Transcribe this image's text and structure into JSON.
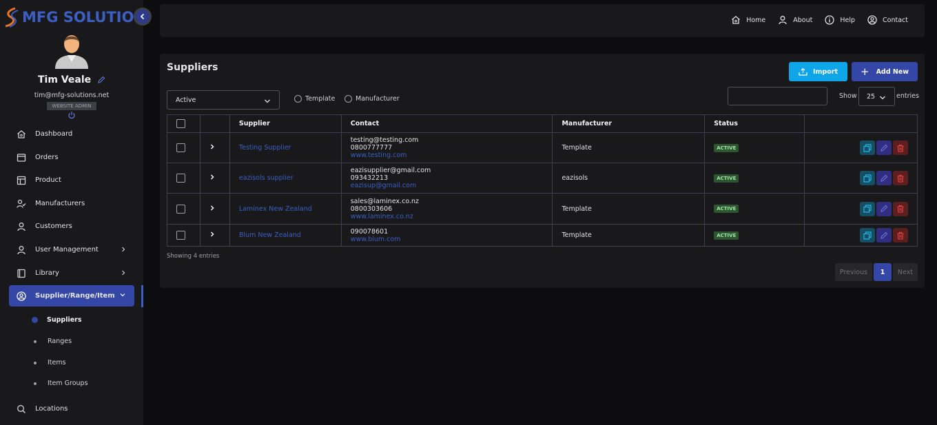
{
  "brand": {
    "name": "MFG SOLUTION"
  },
  "user": {
    "name": "Tim Veale",
    "email": "tim@mfg-solutions.net",
    "role": "WEBSITE ADMIN"
  },
  "sidebar": {
    "items": [
      {
        "label": "Dashboard",
        "icon": "home-icon"
      },
      {
        "label": "Orders",
        "icon": "orders-icon"
      },
      {
        "label": "Product",
        "icon": "product-icon"
      },
      {
        "label": "Manufacturers",
        "icon": "manufacturers-icon"
      },
      {
        "label": "Customers",
        "icon": "user-icon"
      },
      {
        "label": "User Management",
        "icon": "user-icon"
      },
      {
        "label": "Library",
        "icon": "book-icon"
      },
      {
        "label": "Supplier/Range/Item",
        "icon": "user-circle-icon"
      },
      {
        "label": "Locations",
        "icon": "search-icon"
      }
    ],
    "subitems": [
      "Suppliers",
      "Ranges",
      "Items",
      "Item Groups"
    ]
  },
  "topnav": {
    "home": "Home",
    "about": "About",
    "help": "Help",
    "contact": "Contact"
  },
  "page": {
    "title": "Suppliers",
    "import_label": "Import",
    "add_label": "Add New",
    "status_filter": "Active",
    "radio_template": "Template",
    "radio_manufacturer": "Manufacturer",
    "show_label": "Show",
    "page_size": "25",
    "entries_label": "entries",
    "showing_text": "Showing 4 entries",
    "pager": {
      "previous": "Previous",
      "current": "1",
      "next": "Next"
    }
  },
  "table": {
    "headers": {
      "supplier": "Supplier",
      "contact": "Contact",
      "manufacturer": "Manufacturer",
      "status": "Status"
    },
    "rows": [
      {
        "supplier": "Testing Supplier",
        "email": "testing@testing.com",
        "phone": "0800777777",
        "web": "www.testing.com",
        "manufacturer": "Template",
        "status": "ACTIVE"
      },
      {
        "supplier": "eazisols supplier",
        "email": "eazisupplier@gmail.com",
        "phone": "093432213",
        "web": "eazisup@gmail.com",
        "manufacturer": "eazisols",
        "status": "ACTIVE"
      },
      {
        "supplier": "Laminex New Zealand",
        "email": "sales@laminex.co.nz",
        "phone": "0800303606",
        "web": "www.laminex.co.nz",
        "manufacturer": "Template",
        "status": "ACTIVE"
      },
      {
        "supplier": "Blum New Zealand",
        "email": "",
        "phone": "090078601",
        "web": "www.blum.com",
        "manufacturer": "Template",
        "status": "ACTIVE"
      }
    ]
  },
  "colors": {
    "accent": "#3447a6",
    "import": "#0ea5e9",
    "active_badge": "#2f5431"
  }
}
